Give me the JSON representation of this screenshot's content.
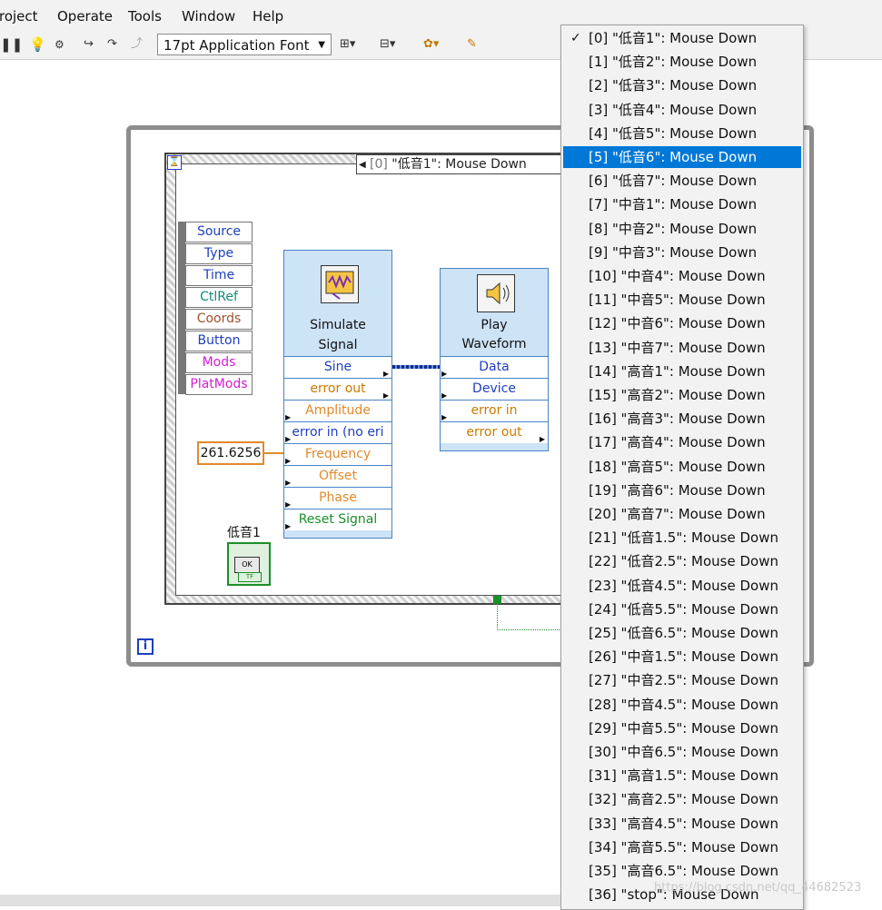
{
  "menubar": {
    "items": [
      "roject",
      "Operate",
      "Tools",
      "Window",
      "Help"
    ]
  },
  "toolbar": {
    "font_select": "17pt Application Font",
    "icons": [
      "pause-icon",
      "highlight-bulb-icon",
      "retain-wire-values-icon",
      "step-into-icon",
      "step-over-icon",
      "step-out-icon",
      "align-objects-icon",
      "distribute-objects-icon",
      "reorder-icon",
      "cleanup-diagram-icon"
    ]
  },
  "diagram": {
    "case_selector": {
      "index": "[0]",
      "label": "\"低音1\": Mouse Down"
    },
    "event_data_node": [
      "Source",
      "Type",
      "Time",
      "CtlRef",
      "Coords",
      "Button",
      "Mods",
      "PlatMods"
    ],
    "event_data_colors": [
      "#1e3fbf",
      "#1e3fbf",
      "#1e3fbf",
      "#138a78",
      "#a0522d",
      "#1e3fbf",
      "#d21ed2",
      "#d21ed2"
    ],
    "frequency_constant": "261.6256",
    "simulate_signal": {
      "title_line1": "Simulate",
      "title_line2": "Signal",
      "pins": [
        "Sine",
        "error out",
        "Amplitude",
        "error in (no eri",
        "Frequency",
        "Offset",
        "Phase",
        "Reset Signal"
      ],
      "pin_colors": [
        "#1e3fbf",
        "#cc7a00",
        "#e2892b",
        "#1e3fbf",
        "#e2892b",
        "#e2892b",
        "#e2892b",
        "#1c8f2a"
      ]
    },
    "play_waveform": {
      "title_line1": "Play",
      "title_line2": "Waveform",
      "pins": [
        "Data",
        "Device",
        "error in",
        "error out"
      ],
      "pin_colors": [
        "#1e3fbf",
        "#1e3fbf",
        "#cc7a00",
        "#cc7a00"
      ]
    },
    "ok_button": {
      "label": "低音1",
      "text": "OK",
      "terminal": "TF"
    },
    "info_icon": "i"
  },
  "dropdown": {
    "selected_index": 5,
    "checked_index": 0,
    "options": [
      "[0] \"低音1\": Mouse Down",
      "[1] \"低音2\": Mouse Down",
      "[2] \"低音3\": Mouse Down",
      "[3] \"低音4\": Mouse Down",
      "[4] \"低音5\": Mouse Down",
      "[5] \"低音6\": Mouse Down",
      "[6] \"低音7\": Mouse Down",
      "[7] \"中音1\": Mouse Down",
      "[8] \"中音2\": Mouse Down",
      "[9] \"中音3\": Mouse Down",
      "[10] \"中音4\": Mouse Down",
      "[11] \"中音5\": Mouse Down",
      "[12] \"中音6\": Mouse Down",
      "[13] \"中音7\": Mouse Down",
      "[14] \"高音1\": Mouse Down",
      "[15] \"高音2\": Mouse Down",
      "[16] \"高音3\": Mouse Down",
      "[17] \"高音4\": Mouse Down",
      "[18] \"高音5\": Mouse Down",
      "[19] \"高音6\": Mouse Down",
      "[20] \"高音7\": Mouse Down",
      "[21] \"低音1.5\": Mouse Down",
      "[22] \"低音2.5\": Mouse Down",
      "[23] \"低音4.5\": Mouse Down",
      "[24] \"低音5.5\": Mouse Down",
      "[25] \"低音6.5\": Mouse Down",
      "[26] \"中音1.5\": Mouse Down",
      "[27] \"中音2.5\": Mouse Down",
      "[28] \"中音4.5\": Mouse Down",
      "[29] \"中音5.5\": Mouse Down",
      "[30] \"中音6.5\": Mouse Down",
      "[31] \"高音1.5\": Mouse Down",
      "[32] \"高音2.5\": Mouse Down",
      "[33] \"高音4.5\": Mouse Down",
      "[34] \"高音5.5\": Mouse Down",
      "[35] \"高音6.5\": Mouse Down",
      "[36] \"stop\": Mouse Down"
    ]
  },
  "watermark": "https://blog.csdn.net/qq_44682523"
}
